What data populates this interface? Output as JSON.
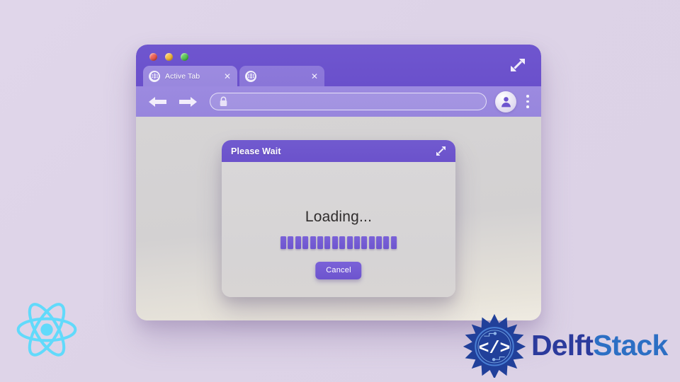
{
  "background": {
    "color": "#ded4e8"
  },
  "browser": {
    "titlebar": {
      "traffic_lights": [
        {
          "name": "close",
          "color": "#d93f34"
        },
        {
          "name": "minimize",
          "color": "#e8a316"
        },
        {
          "name": "maximize",
          "color": "#36ad38"
        }
      ],
      "expand_icon": "expand-diagonal-icon",
      "accent_color": "#6a50cb"
    },
    "tabs": [
      {
        "label": "Active Tab",
        "favicon": "globe-icon",
        "close": "✕",
        "active": true
      },
      {
        "label": "",
        "favicon": "globe-icon",
        "close": "✕",
        "active": false
      }
    ],
    "toolbar": {
      "back_icon": "arrow-left-icon",
      "forward_icon": "arrow-right-icon",
      "address_bar": {
        "lock_icon": "lock-icon",
        "value": "",
        "placeholder": ""
      },
      "profile_icon": "user-avatar-icon",
      "menu_icon": "kebab-menu-icon",
      "accent_color": "#9786dd"
    },
    "content_color": "#d4d2d3"
  },
  "dialog": {
    "title": "Please Wait",
    "expand_icon": "expand-diagonal-icon",
    "loading_text": "Loading...",
    "progress": {
      "segments": 16,
      "filled": 16,
      "color": "#6e55cf"
    },
    "cancel_label": "Cancel",
    "accent_color": "#6b52cb"
  },
  "branding": {
    "react": {
      "name": "react-logo",
      "color": "#61dafb"
    },
    "delftstack": {
      "word_primary": "Delft",
      "word_secondary": "Stack",
      "primary_color": "#2b3a9c",
      "secondary_color": "#2c6fc4",
      "emblem_glyph": "</>"
    }
  }
}
